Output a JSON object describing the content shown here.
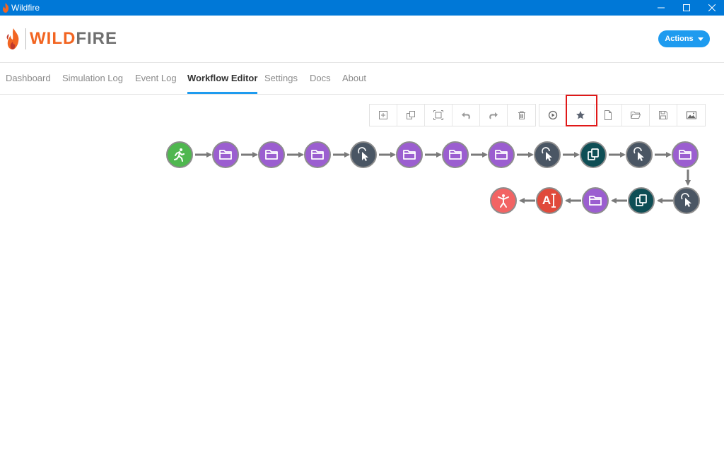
{
  "window": {
    "title": "Wildfire"
  },
  "header": {
    "logo_part1": "WILD",
    "logo_part2": "FIRE",
    "actions_label": "Actions"
  },
  "nav": {
    "tabs": [
      {
        "label": "Dashboard",
        "active": false
      },
      {
        "label": "Simulation Log",
        "active": false
      },
      {
        "label": "Event Log",
        "active": false
      },
      {
        "label": "Workflow Editor",
        "active": true
      },
      {
        "label": "Settings",
        "active": false
      },
      {
        "label": "Docs",
        "active": false
      },
      {
        "label": "About",
        "active": false
      }
    ]
  },
  "toolbar": {
    "group1": [
      "add-icon",
      "duplicate-icon",
      "fit-view-icon",
      "undo-icon",
      "redo-icon",
      "delete-icon"
    ],
    "group2": [
      "play-icon",
      "favorite-star-icon",
      "new-file-icon",
      "open-folder-icon",
      "save-icon",
      "export-image-icon"
    ]
  },
  "workflow": {
    "nodes": [
      {
        "type": "start",
        "icon": "runner-icon"
      },
      {
        "type": "open-folder",
        "icon": "folder-icon"
      },
      {
        "type": "open-folder",
        "icon": "folder-icon"
      },
      {
        "type": "open-folder",
        "icon": "folder-icon"
      },
      {
        "type": "click",
        "icon": "pointer-click-icon"
      },
      {
        "type": "open-folder",
        "icon": "folder-icon"
      },
      {
        "type": "open-folder",
        "icon": "folder-icon"
      },
      {
        "type": "open-folder",
        "icon": "folder-icon"
      },
      {
        "type": "click",
        "icon": "pointer-click-icon"
      },
      {
        "type": "copy",
        "icon": "copy-icon"
      },
      {
        "type": "click",
        "icon": "pointer-click-icon"
      },
      {
        "type": "open-folder",
        "icon": "folder-icon"
      },
      {
        "type": "click",
        "icon": "pointer-click-icon"
      },
      {
        "type": "copy",
        "icon": "copy-icon"
      },
      {
        "type": "open-folder",
        "icon": "folder-icon"
      },
      {
        "type": "type-text",
        "icon": "text-input-icon",
        "label": "A"
      },
      {
        "type": "end",
        "icon": "stop-figure-icon"
      }
    ]
  },
  "colors": {
    "titlebar": "#0078d7",
    "accent": "#1e9bef",
    "logo_orange": "#f26522",
    "node_folder": "#9b5ed0",
    "node_click": "#4a5664",
    "node_copy": "#0e4e55",
    "node_start": "#4fb74f",
    "node_text": "#e04a3b",
    "node_end": "#f26464",
    "highlight": "#e01818"
  }
}
